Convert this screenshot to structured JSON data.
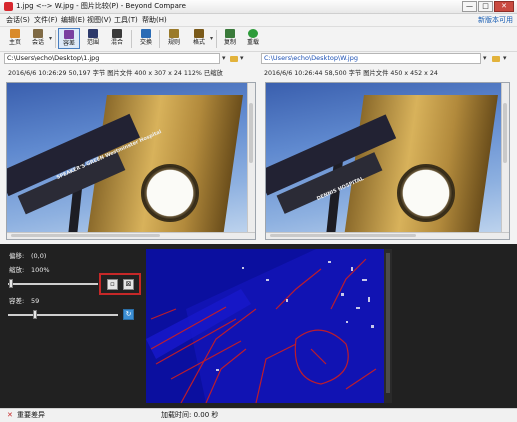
{
  "window": {
    "title": "1.jpg <--> W.jpg - 图片比较(P) - Beyond Compare",
    "minimize": "—",
    "maximize": "□",
    "close": "✕"
  },
  "menu": {
    "items": [
      "会话(S)",
      "文件(F)",
      "编辑(E)",
      "视图(V)",
      "工具(T)",
      "帮助(H)"
    ],
    "help_link": "新版本可用"
  },
  "toolbar": {
    "buttons": [
      {
        "label": "主页",
        "icon": "home-icon",
        "color": "#d98a2b"
      },
      {
        "label": "会话",
        "icon": "session-icon",
        "color": "#7f6a45"
      },
      {
        "label": "容差",
        "icon": "tolerance-icon",
        "color": "#7a3fa0",
        "active": true
      },
      {
        "label": "范围",
        "icon": "range-icon",
        "color": "#2d3a6b"
      },
      {
        "label": "混合",
        "icon": "blend-icon",
        "color": "#3a3a3a"
      },
      {
        "label": "交换",
        "icon": "swap-icon",
        "color": "#2a6bb5"
      },
      {
        "label": "规则",
        "icon": "rules-icon",
        "color": "#9a7a2a"
      },
      {
        "label": "格式",
        "icon": "format-icon",
        "color": "#7a5a1a"
      },
      {
        "label": "复制",
        "icon": "copy-icon",
        "color": "#3a7a3a"
      },
      {
        "label": "重载",
        "icon": "reload-icon",
        "color": "#2d9b3a"
      }
    ]
  },
  "left": {
    "path": "C:\\Users\\echo\\Desktop\\1.jpg",
    "info": "2016/6/6 10:26:29    50,197 字节    图片文件    400 x 307 x 24    112% 已缩放",
    "sign_text": "SPEAKER'S GREEN\nWestminster Hospital"
  },
  "right": {
    "path": "C:\\Users\\echo\\Desktop\\W.jpg",
    "info": "2016/6/6 10:26:44    58,500 字节    图片文件    450 x 452 x 24",
    "sign_text": "DENNIS HOSPITAL"
  },
  "controls": {
    "offset_label": "偏移:",
    "offset_value": "(0,0)",
    "zoom_label": "缩放:",
    "zoom_value": "100%",
    "tolerance_label": "容差:",
    "tolerance_value": "59",
    "fit_button_icon": "fit-icon",
    "actual_size_button_icon": "actual-size-icon",
    "refresh_button_icon": "refresh-icon",
    "zoom_level": 0.0,
    "tolerance_level": 0.23
  },
  "status": {
    "mark": "✕",
    "left": "重要差异",
    "center": "加载时间: 0.00 秒"
  }
}
